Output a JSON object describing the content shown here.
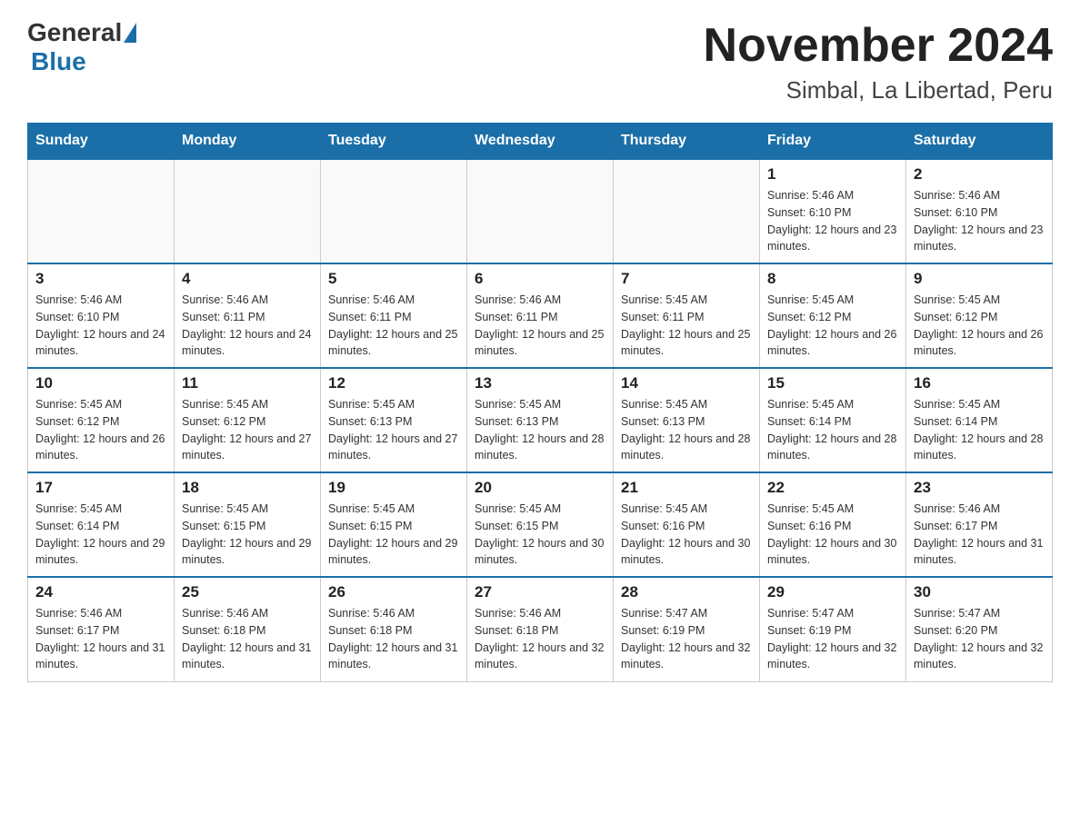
{
  "header": {
    "logo_general": "General",
    "logo_blue": "Blue",
    "month_title": "November 2024",
    "location": "Simbal, La Libertad, Peru"
  },
  "days_of_week": [
    "Sunday",
    "Monday",
    "Tuesday",
    "Wednesday",
    "Thursday",
    "Friday",
    "Saturday"
  ],
  "weeks": [
    [
      {
        "day": "",
        "info": ""
      },
      {
        "day": "",
        "info": ""
      },
      {
        "day": "",
        "info": ""
      },
      {
        "day": "",
        "info": ""
      },
      {
        "day": "",
        "info": ""
      },
      {
        "day": "1",
        "info": "Sunrise: 5:46 AM\nSunset: 6:10 PM\nDaylight: 12 hours and 23 minutes."
      },
      {
        "day": "2",
        "info": "Sunrise: 5:46 AM\nSunset: 6:10 PM\nDaylight: 12 hours and 23 minutes."
      }
    ],
    [
      {
        "day": "3",
        "info": "Sunrise: 5:46 AM\nSunset: 6:10 PM\nDaylight: 12 hours and 24 minutes."
      },
      {
        "day": "4",
        "info": "Sunrise: 5:46 AM\nSunset: 6:11 PM\nDaylight: 12 hours and 24 minutes."
      },
      {
        "day": "5",
        "info": "Sunrise: 5:46 AM\nSunset: 6:11 PM\nDaylight: 12 hours and 25 minutes."
      },
      {
        "day": "6",
        "info": "Sunrise: 5:46 AM\nSunset: 6:11 PM\nDaylight: 12 hours and 25 minutes."
      },
      {
        "day": "7",
        "info": "Sunrise: 5:45 AM\nSunset: 6:11 PM\nDaylight: 12 hours and 25 minutes."
      },
      {
        "day": "8",
        "info": "Sunrise: 5:45 AM\nSunset: 6:12 PM\nDaylight: 12 hours and 26 minutes."
      },
      {
        "day": "9",
        "info": "Sunrise: 5:45 AM\nSunset: 6:12 PM\nDaylight: 12 hours and 26 minutes."
      }
    ],
    [
      {
        "day": "10",
        "info": "Sunrise: 5:45 AM\nSunset: 6:12 PM\nDaylight: 12 hours and 26 minutes."
      },
      {
        "day": "11",
        "info": "Sunrise: 5:45 AM\nSunset: 6:12 PM\nDaylight: 12 hours and 27 minutes."
      },
      {
        "day": "12",
        "info": "Sunrise: 5:45 AM\nSunset: 6:13 PM\nDaylight: 12 hours and 27 minutes."
      },
      {
        "day": "13",
        "info": "Sunrise: 5:45 AM\nSunset: 6:13 PM\nDaylight: 12 hours and 28 minutes."
      },
      {
        "day": "14",
        "info": "Sunrise: 5:45 AM\nSunset: 6:13 PM\nDaylight: 12 hours and 28 minutes."
      },
      {
        "day": "15",
        "info": "Sunrise: 5:45 AM\nSunset: 6:14 PM\nDaylight: 12 hours and 28 minutes."
      },
      {
        "day": "16",
        "info": "Sunrise: 5:45 AM\nSunset: 6:14 PM\nDaylight: 12 hours and 28 minutes."
      }
    ],
    [
      {
        "day": "17",
        "info": "Sunrise: 5:45 AM\nSunset: 6:14 PM\nDaylight: 12 hours and 29 minutes."
      },
      {
        "day": "18",
        "info": "Sunrise: 5:45 AM\nSunset: 6:15 PM\nDaylight: 12 hours and 29 minutes."
      },
      {
        "day": "19",
        "info": "Sunrise: 5:45 AM\nSunset: 6:15 PM\nDaylight: 12 hours and 29 minutes."
      },
      {
        "day": "20",
        "info": "Sunrise: 5:45 AM\nSunset: 6:15 PM\nDaylight: 12 hours and 30 minutes."
      },
      {
        "day": "21",
        "info": "Sunrise: 5:45 AM\nSunset: 6:16 PM\nDaylight: 12 hours and 30 minutes."
      },
      {
        "day": "22",
        "info": "Sunrise: 5:45 AM\nSunset: 6:16 PM\nDaylight: 12 hours and 30 minutes."
      },
      {
        "day": "23",
        "info": "Sunrise: 5:46 AM\nSunset: 6:17 PM\nDaylight: 12 hours and 31 minutes."
      }
    ],
    [
      {
        "day": "24",
        "info": "Sunrise: 5:46 AM\nSunset: 6:17 PM\nDaylight: 12 hours and 31 minutes."
      },
      {
        "day": "25",
        "info": "Sunrise: 5:46 AM\nSunset: 6:18 PM\nDaylight: 12 hours and 31 minutes."
      },
      {
        "day": "26",
        "info": "Sunrise: 5:46 AM\nSunset: 6:18 PM\nDaylight: 12 hours and 31 minutes."
      },
      {
        "day": "27",
        "info": "Sunrise: 5:46 AM\nSunset: 6:18 PM\nDaylight: 12 hours and 32 minutes."
      },
      {
        "day": "28",
        "info": "Sunrise: 5:47 AM\nSunset: 6:19 PM\nDaylight: 12 hours and 32 minutes."
      },
      {
        "day": "29",
        "info": "Sunrise: 5:47 AM\nSunset: 6:19 PM\nDaylight: 12 hours and 32 minutes."
      },
      {
        "day": "30",
        "info": "Sunrise: 5:47 AM\nSunset: 6:20 PM\nDaylight: 12 hours and 32 minutes."
      }
    ]
  ]
}
